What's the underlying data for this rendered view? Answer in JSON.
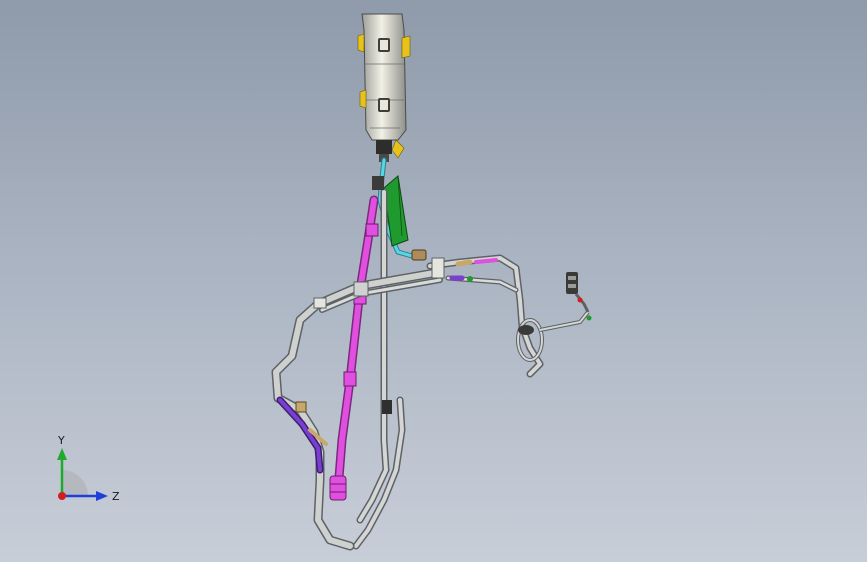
{
  "view": {
    "background_top": "#8f9aaa",
    "background_bottom": "#c8ced8"
  },
  "model": {
    "colors": {
      "tube": "#c9cbc9",
      "tube_edge": "#5e6266",
      "magenta_pipe": "#e04fe0",
      "purple_pipe": "#7a3fd0",
      "cyan_pipe": "#56d6e6",
      "green_panel": "#1f9a2e",
      "yellow_bracket": "#e8c21a",
      "tan_sleeve": "#c8a86a"
    }
  },
  "triad": {
    "y_label": "Y",
    "z_label": "Z",
    "y_color": "#1faa2e",
    "z_color": "#1f3fd8",
    "x_color": "#d01f1f"
  }
}
